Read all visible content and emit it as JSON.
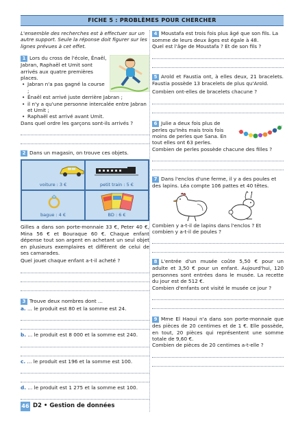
{
  "header": "FICHE 5 : PROBLÈMES POUR CHERCHER",
  "intro": "L'ensemble des recherches est à effectuer sur un autre support. Seule la réponse doit figurer sur les lignes prévues à cet effet.",
  "p1": {
    "num": "1",
    "text": "Lors du cross de l'école, Énaël, Jabran, Raphaël et Umit sont arrivés aux quatre premières places.",
    "bullets": [
      "Jabran n'a pas gagné la course ;",
      "Énaël est arrivé juste derrière Jabran ;",
      "il n'y a qu'une personne intercalée entre Jabran et Umit ;",
      "Raphaël est arrivé avant Umit."
    ],
    "question": "Dans quel ordre les garçons sont-ils arrivés ?"
  },
  "p2": {
    "num": "2",
    "text": "Dans un magasin, on trouve ces objets.",
    "objects": [
      "voiture : 3 €",
      "petit train : 5 €",
      "bague : 4 €",
      "BD : 6 €"
    ],
    "body": "Gilles a dans son porte-monnaie 33 €, Peter 40 €, Mina 56 € et Bouraque 60 €. Chaque enfant dépense tout son argent en achetant un seul objet en plusieurs exemplaires et différent de celui de ses camarades.",
    "question": "Quel jouet chaque enfant a-t-il acheté ?"
  },
  "p3": {
    "num": "3",
    "text": "Trouve deux nombres dont ...",
    "items": [
      {
        "letter": "a.",
        "text": "... le produit est 80 et la somme est 24."
      },
      {
        "letter": "b.",
        "text": "... le produit est 8 000 et la somme est 240."
      },
      {
        "letter": "c.",
        "text": "... le produit est 196 et la somme est 100."
      },
      {
        "letter": "d.",
        "text": "... le produit est 1 275 et la somme est 100."
      }
    ]
  },
  "p4": {
    "num": "4",
    "text": "Moustafa est trois fois plus âgé que son fils. La somme de leurs deux âges est égale à 48.",
    "question": "Quel est l'âge de Moustafa ? Et de son fils ?"
  },
  "p5": {
    "num": "5",
    "text": "Arold et Faustia ont, à elles deux, 21 bracelets. Faustia possède 13 bracelets de plus qu'Arold.",
    "question": "Combien ont-elles de bracelets chacune ?"
  },
  "p6": {
    "num": "6",
    "text": "Julie a deux fois plus de perles qu'Inès mais trois fois moins de perles que Sana. En tout elles ont 63 perles.",
    "question": "Combien de perles possède chacune des filles ?"
  },
  "p7": {
    "num": "7",
    "text": "Dans l'enclos d'une ferme, il y a des poules et des lapins. Léa compte 106 pattes et 40 têtes.",
    "question": "Combien y a-t-il de lapins dans l'enclos ? Et combien y a-t-il de poules ?"
  },
  "p8": {
    "num": "8",
    "text": "L'entrée d'un musée coûte 5,50 € pour un adulte et 3,50 € pour un enfant. Aujourd'hui, 120 personnes sont entrées dans le musée. La recette du jour est de 512 €.",
    "question": "Combien d'enfants ont visité le musée ce jour ?"
  },
  "p9": {
    "num": "9",
    "text": "Mme El Haoui n'a dans son porte-monnaie que des pièces de 20 centimes et de 1 €. Elle possède, en tout, 20 pièces qui représentent une somme totale de 9,60 €.",
    "question": "Combien de pièces de 20 centimes a-t-elle ?"
  },
  "footer": {
    "page": "46",
    "title": "D2 • Gestion de données"
  },
  "colors": {
    "accent": "#6aa6dd",
    "header_bg": "#9ec3e6",
    "frame": "#3c6ea8"
  },
  "icons": [
    "running-boy-illustration",
    "toy-car-icon",
    "toy-train-icon",
    "ring-icon",
    "comic-books-icon",
    "bead-necklace-illustration",
    "hen-illustration",
    "rabbit-illustration"
  ]
}
